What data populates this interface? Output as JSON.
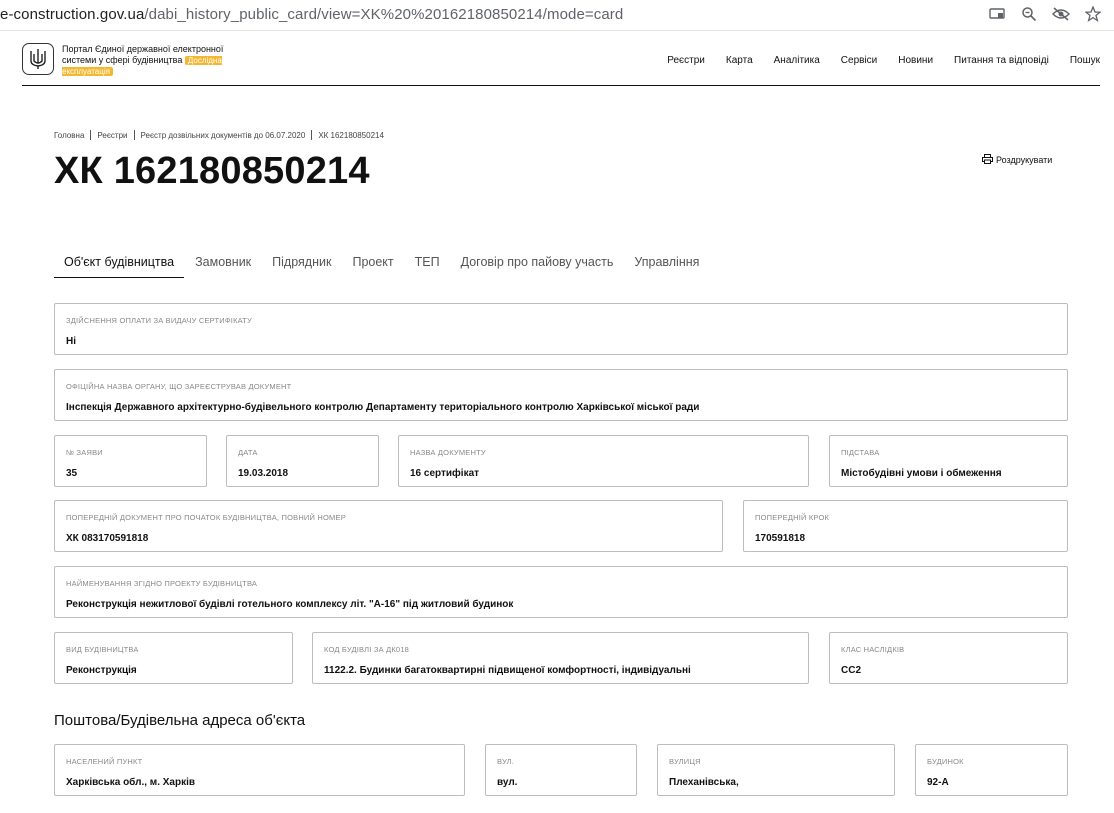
{
  "browser": {
    "url_host": "e-construction.gov.ua",
    "url_path": "/dabi_history_public_card/view=XK%20%20162180850214/mode=card"
  },
  "header": {
    "portal_name": "Портал Єдиної державної електронної системи у сфері будівництва",
    "badge": "Дослідна експлуатація",
    "nav": [
      "Реєстри",
      "Карта",
      "Аналітика",
      "Сервіси",
      "Новини",
      "Питання та відповіді",
      "Пошук"
    ]
  },
  "breadcrumb": [
    "Головна",
    "Реєстри",
    "Реєстр дозвільних документів до 06.07.2020",
    "ХК 162180850214"
  ],
  "page_title": "ХК 162180850214",
  "print_label": "Роздрукувати",
  "tabs": [
    "Об'єкт будівництва",
    "Замовник",
    "Підрядник",
    "Проект",
    "ТЕП",
    "Договір про пайову участь",
    "Управління"
  ],
  "fields": {
    "payment": {
      "label": "Здійснення оплати за видачу сертифікату",
      "value": "Ні"
    },
    "authority": {
      "label": "Офіційна назва органу, що зареєстрував документ",
      "value": "Інспекція Державного архітектурно-будівельного контролю Департаменту територіального контролю Харківської міської ради"
    },
    "app_no": {
      "label": "№ заяви",
      "value": "35"
    },
    "date": {
      "label": "Дата",
      "value": "19.03.2018"
    },
    "doc_name": {
      "label": "Назва документу",
      "value": "16 сертифікат"
    },
    "basis": {
      "label": "Підстава",
      "value": "Містобудівні умови і обмеження"
    },
    "prev_doc": {
      "label": "Попередній документ про початок будівництва, повний номер",
      "value": "ХК 083170591818"
    },
    "prev_step": {
      "label": "Попередній крок",
      "value": "170591818"
    },
    "project_name": {
      "label": "Найменування згідно проекту будівництва",
      "value": "Реконструкція нежитлової будівлі готельного комплексу літ. \"А-16\" під житловий будинок"
    },
    "build_type": {
      "label": "Вид будівництва",
      "value": "Реконструкція"
    },
    "building_code": {
      "label": "Код будівлі за ДК018",
      "value": "1122.2. Будинки багатоквартирні підвищеної комфортності, індивідуальні"
    },
    "consequence_class": {
      "label": "Клас наслідків",
      "value": "СС2"
    }
  },
  "address_section": {
    "title": "Поштова/Будівельна адреса об'єкта",
    "settlement": {
      "label": "Населений пункт",
      "value": "Харківська обл., м. Харків"
    },
    "street_type": {
      "label": "Вул.",
      "value": "вул."
    },
    "street": {
      "label": "Вулиця",
      "value": "Плеханівська,"
    },
    "building": {
      "label": "Будинок",
      "value": "92-А"
    }
  }
}
